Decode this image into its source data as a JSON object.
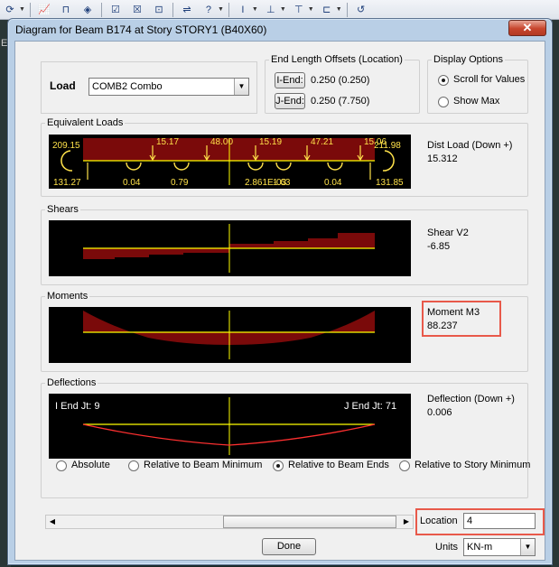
{
  "toolbar": {
    "icons": [
      "refresh-icon",
      "chart-icon",
      "frame-icon",
      "paint-icon",
      "check-icon",
      "cross-icon",
      "dl-icon",
      "link-icon",
      "question-icon",
      "beam-icon",
      "column-icon",
      "brace-icon",
      "bracket-icon",
      "undo-icon"
    ]
  },
  "background": {
    "left_letter": "E"
  },
  "window": {
    "title": "Diagram for Beam B174 at Story STORY1 (B40X60)",
    "close_glyph": "✕"
  },
  "load": {
    "label": "Load",
    "selected": "COMB2 Combo"
  },
  "end_offsets": {
    "legend": "End Length Offsets (Location)",
    "i_end_button": "I-End:",
    "i_end_value": "0.250  (0.250)",
    "j_end_button": "J-End:",
    "j_end_value": "0.250  (7.750)"
  },
  "display_options": {
    "legend": "Display Options",
    "scroll_for_values": "Scroll for Values",
    "show_max": "Show Max",
    "selected": "Scroll for Values"
  },
  "equivalent_loads": {
    "legend": "Equivalent Loads",
    "side_title": "Dist Load (Down +)",
    "side_value": "15.312",
    "left_moment": "209.15",
    "right_moment": "211.98",
    "left_reaction": "131.27",
    "right_reaction": "131.85",
    "point_loads": [
      "15.17",
      "48.00",
      "15.19",
      "47.21",
      "15.06"
    ],
    "point_moments": [
      "0.04",
      "0.79",
      "2.861E-03",
      "1.63",
      "0.04"
    ]
  },
  "shears": {
    "legend": "Shears",
    "side_title": "Shear V2",
    "side_value": "-6.85"
  },
  "moments": {
    "legend": "Moments",
    "side_title": "Moment M3",
    "side_value": "88.237"
  },
  "deflections": {
    "legend": "Deflections",
    "side_title": "Deflection (Down +)",
    "side_value": "0.006",
    "i_end_label": "I End Jt: 9",
    "j_end_label": "J End Jt: 71",
    "options": [
      "Absolute",
      "Relative to Beam Minimum",
      "Relative to Beam Ends",
      "Relative to Story Minimum"
    ],
    "selected": "Relative to Beam Ends"
  },
  "location": {
    "label": "Location",
    "value": "4"
  },
  "done_button": "Done",
  "units": {
    "label": "Units",
    "selected": "KN-m"
  },
  "colors": {
    "diagram_bg": "#000000",
    "diagram_fill": "#7a0a0a",
    "axis_line": "#ffff00",
    "label_yellow": "#ffe24a",
    "deflection_curve": "#ff3030",
    "highlight": "#e8594a"
  }
}
